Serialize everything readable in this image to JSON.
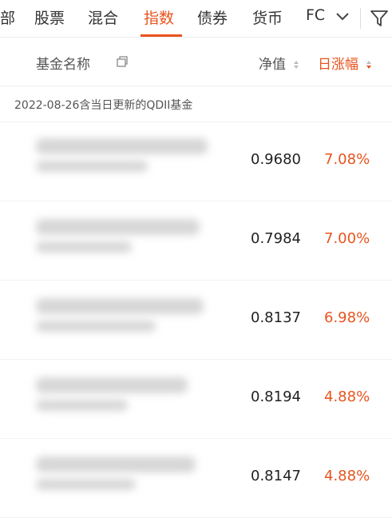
{
  "tabs": [
    "部",
    "股票",
    "混合",
    "指数",
    "债券",
    "货币",
    "FC"
  ],
  "active_tab": "指数",
  "columns": {
    "name": "基金名称",
    "nav": "净值",
    "change": "日涨幅"
  },
  "notice": "2022-08-26含当日更新的QDII基金",
  "funds": [
    {
      "nav": "0.9680",
      "change": "7.08%"
    },
    {
      "nav": "0.7984",
      "change": "7.00%"
    },
    {
      "nav": "0.8137",
      "change": "6.98%"
    },
    {
      "nav": "0.8194",
      "change": "4.88%"
    },
    {
      "nav": "0.8147",
      "change": "4.88%"
    }
  ],
  "colors": {
    "accent": "#e8541e",
    "text": "#333333",
    "muted": "#555555"
  },
  "icons": [
    "chevron-down-icon",
    "filter-icon",
    "copy-icon",
    "sort-icon"
  ]
}
